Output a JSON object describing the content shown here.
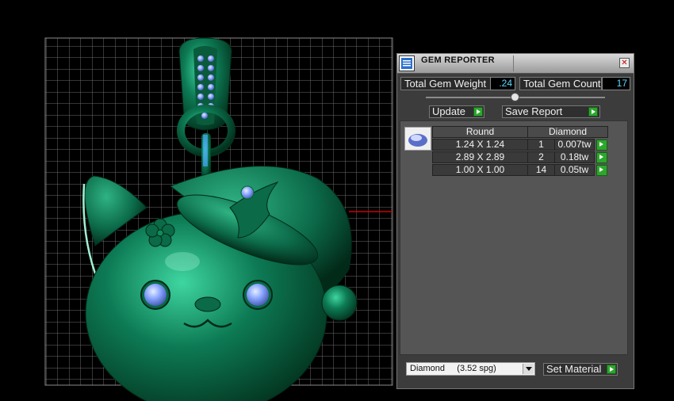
{
  "panel": {
    "title": "GEM REPORTER",
    "total_weight_label": "Total Gem Weight",
    "total_weight_value": ".24",
    "total_count_label": "Total Gem Count",
    "total_count_value": "17",
    "update_label": "Update",
    "save_report_label": "Save Report",
    "close_symbol": "✕"
  },
  "table": {
    "headers": [
      "Round",
      "Diamond"
    ],
    "rows": [
      {
        "size": "1.24 X 1.24",
        "count": "1",
        "weight": "0.007tw"
      },
      {
        "size": "2.89 X 2.89",
        "count": "2",
        "weight": "0.18tw"
      },
      {
        "size": "1.00 X 1.00",
        "count": "14",
        "weight": "0.05tw"
      }
    ]
  },
  "material": {
    "selected": "Diamond     (3.52 spg)",
    "set_material_label": "Set Material"
  },
  "colors": {
    "model_green": "#0f7a55",
    "gem_blue": "#9bb4ff",
    "accent_green": "#2da62d"
  },
  "icons": [
    "gem-reporter-icon",
    "close-icon",
    "play-arrow-icon",
    "dropdown-arrow-icon",
    "gem-thumbnail-icon"
  ]
}
